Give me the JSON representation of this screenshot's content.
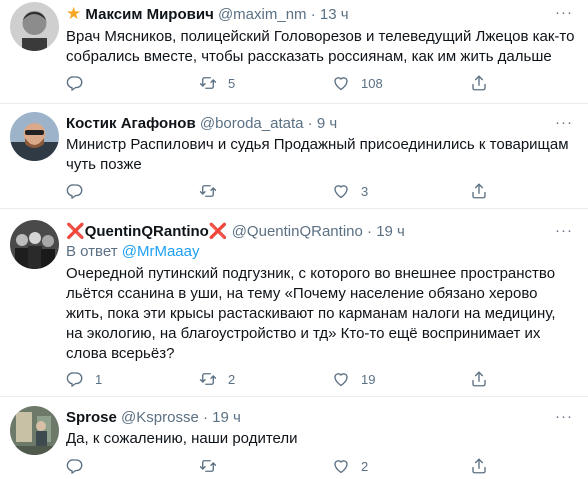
{
  "tweets": [
    {
      "name": "Максим Мирович",
      "name_prefix_icon": "star-emoji",
      "handle": "@maxim_nm",
      "dot": "·",
      "time": "13 ч",
      "text": "Врач Мясников, полицейский Головорезов и телеведущий Лжецов как-то собрались вместе, чтобы рассказать россиянам, как им жить дальше",
      "reply_count": "",
      "retweet_count": "5",
      "like_count": "108"
    },
    {
      "name": "Костик Агафонов",
      "handle": "@boroda_atata",
      "dot": "·",
      "time": "9 ч",
      "text": "Министр Распилович и судья Продажный присоединились к товарищам чуть позже",
      "reply_count": "",
      "retweet_count": "",
      "like_count": "3"
    },
    {
      "name": "QuentinQRantino",
      "name_decoration": "❌",
      "handle": "@QuentinQRantino",
      "dot": "·",
      "time": "19 ч",
      "reply_prefix": "В ответ",
      "reply_to": "@MrMaaay",
      "text": "Очередной путинский подгузник, с которого во внешнее пространство льётся ссанина в уши, на тему «Почему население обязано херово жить, пока эти крысы растаскивают по карманам налоги на медицину, на экологию, на благоустройство и тд» Кто-то ещё воспринимает их слова всерьёз?",
      "reply_count": "1",
      "retweet_count": "2",
      "like_count": "19"
    },
    {
      "name": "Sprose",
      "handle": "@Ksprosse",
      "dot": "·",
      "time": "19 ч",
      "text": "Да, к сожалению, наши родители",
      "reply_count": "",
      "retweet_count": "",
      "like_count": "2"
    }
  ],
  "colors": {
    "text": "#0f1419",
    "secondary": "#5b7083",
    "link": "#1da1f2",
    "divider": "#e6ecf0",
    "red_x": "#d8232a"
  },
  "icons": [
    "reply-icon",
    "retweet-icon",
    "like-icon",
    "share-icon",
    "more-icon"
  ]
}
